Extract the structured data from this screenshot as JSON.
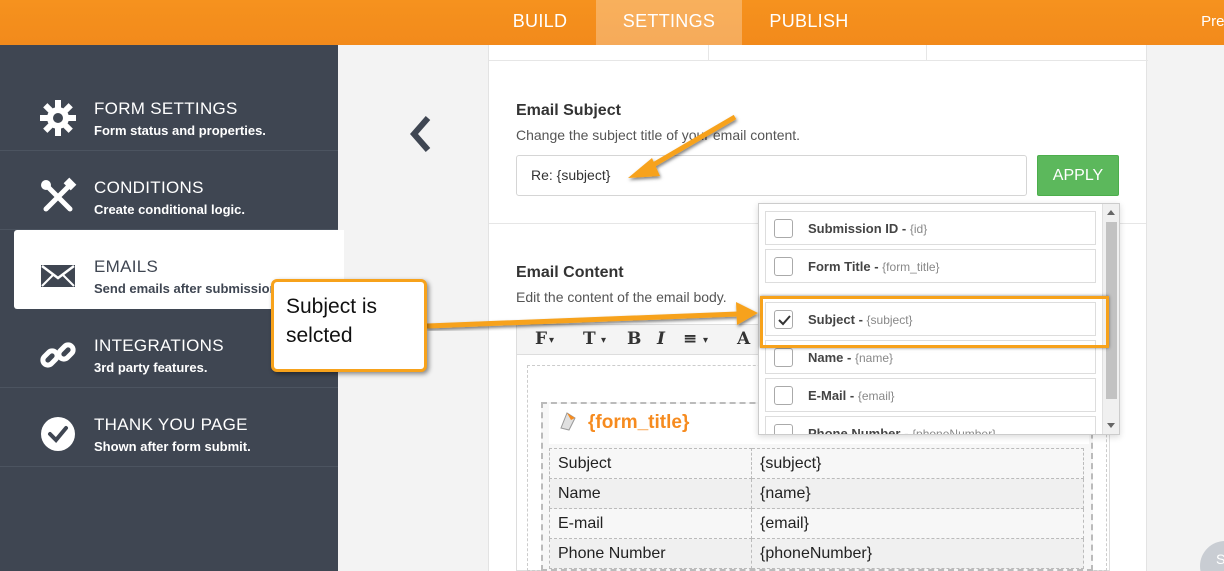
{
  "topbar": {
    "tabs": [
      {
        "label": "BUILD",
        "active": false
      },
      {
        "label": "SETTINGS",
        "active": true
      },
      {
        "label": "PUBLISH",
        "active": false
      }
    ],
    "preview_label": "Prev"
  },
  "sidebar": {
    "items": [
      {
        "title": "FORM SETTINGS",
        "subtitle": "Form status and properties.",
        "icon": "gear-icon",
        "active": false
      },
      {
        "title": "CONDITIONS",
        "subtitle": "Create conditional logic.",
        "icon": "tools-icon",
        "active": false
      },
      {
        "title": "EMAILS",
        "subtitle": "Send emails after submission.",
        "icon": "envelope-icon",
        "active": true
      },
      {
        "title": "INTEGRATIONS",
        "subtitle": "3rd party features.",
        "icon": "link-icon",
        "active": false
      },
      {
        "title": "THANK YOU PAGE",
        "subtitle": "Shown after form submit.",
        "icon": "check-circle-icon",
        "active": false
      }
    ]
  },
  "email_subject": {
    "heading": "Email Subject",
    "description": "Change the subject title of your email content.",
    "value": "Re:  {subject}",
    "apply_label": "APPLY"
  },
  "email_content": {
    "heading": "Email Content",
    "description": "Edit the content of the email body.",
    "toolbar": [
      "F",
      "T",
      "B",
      "I",
      "≡",
      "A"
    ],
    "form_title": "{form_title}",
    "rows": [
      {
        "label": "Subject",
        "value": "{subject}"
      },
      {
        "label": "Name",
        "value": "{name}"
      },
      {
        "label": "E-mail",
        "value": "{email}"
      },
      {
        "label": "Phone Number",
        "value": "{phoneNumber}"
      }
    ]
  },
  "dropdown": {
    "items": [
      {
        "label": "Submission ID",
        "tag": "{id}",
        "checked": false
      },
      {
        "label": "Form Title",
        "tag": "{form_title}",
        "checked": false
      },
      {
        "label": "Subject",
        "tag": "{subject}",
        "checked": true
      },
      {
        "label": "Name",
        "tag": "{name}",
        "checked": false
      },
      {
        "label": "E-Mail",
        "tag": "{email}",
        "checked": false
      },
      {
        "label": "Phone Number",
        "tag": "{phoneNumber}",
        "checked": false
      }
    ]
  },
  "annotation": {
    "callout_text": "Subject is selcted"
  },
  "colors": {
    "brand_orange": "#f6921e",
    "sidebar_bg": "#3f4652",
    "apply_green": "#5cb85c",
    "highlight": "#f7a21b"
  }
}
